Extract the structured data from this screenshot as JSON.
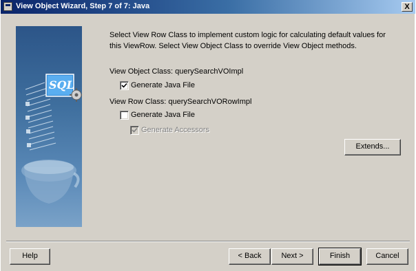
{
  "window": {
    "title": "View Object Wizard, Step 7 of 7: Java",
    "close_label": "X"
  },
  "main": {
    "description": "Select View Row Class to implement custom logic for calculating default values for this ViewRow.  Select View Object Class to override View Object methods.",
    "view_object": {
      "label": "View Object Class: querySearchVOImpl",
      "generate_java": {
        "label": "Generate Java File",
        "checked": true
      }
    },
    "view_row": {
      "label": "View Row Class: querySearchVORowImpl",
      "generate_java": {
        "label": "Generate Java File",
        "checked": false
      },
      "generate_accessors": {
        "label": "Generate Accessors",
        "checked": true,
        "disabled": true
      }
    },
    "extends_label": "Extends..."
  },
  "art": {
    "sql_label": "SQL"
  },
  "footer": {
    "help_label": "Help",
    "back_label": "< Back",
    "next_label": "Next >",
    "finish_label": "Finish",
    "cancel_label": "Cancel"
  }
}
